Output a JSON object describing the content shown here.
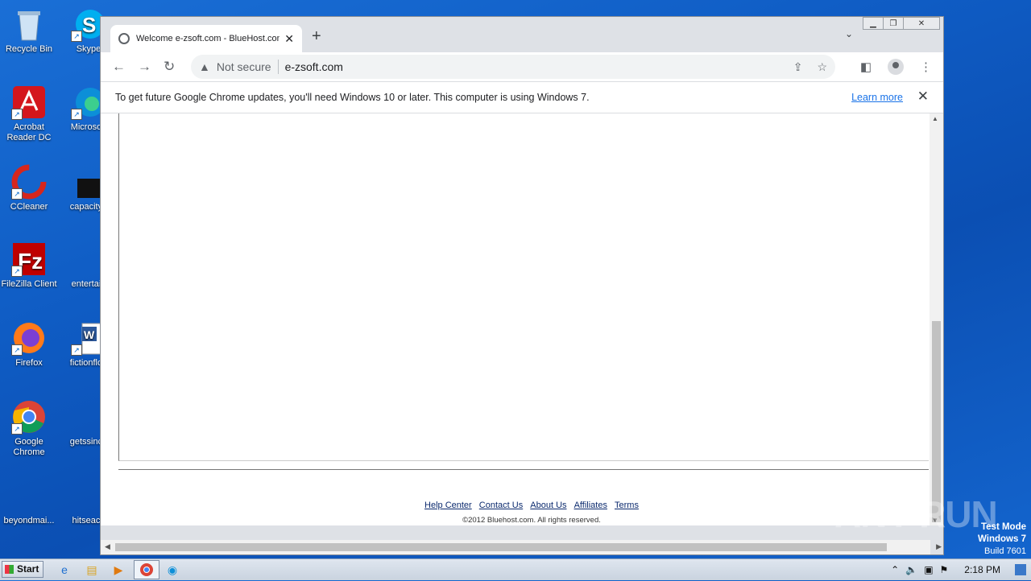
{
  "desktop": {
    "icons_col1": [
      {
        "label": "Recycle Bin",
        "icon": "recycle-bin-icon"
      },
      {
        "label": "Acrobat Reader DC",
        "icon": "acrobat-icon"
      },
      {
        "label": "CCleaner",
        "icon": "ccleaner-icon"
      },
      {
        "label": "FileZilla Client",
        "icon": "filezilla-icon"
      },
      {
        "label": "Firefox",
        "icon": "firefox-icon"
      },
      {
        "label": "Google Chrome",
        "icon": "chrome-icon"
      },
      {
        "label": "beyondmai...",
        "icon": "file-icon"
      }
    ],
    "icons_col2": [
      {
        "label": "Skype",
        "icon": "skype-icon"
      },
      {
        "label": "Microsoft",
        "icon": "edge-icon"
      },
      {
        "label": "capacityb",
        "icon": "file-icon"
      },
      {
        "label": "entertain",
        "icon": "file-icon"
      },
      {
        "label": "fictionflori",
        "icon": "word-icon"
      },
      {
        "label": "getssince",
        "icon": "file-icon"
      },
      {
        "label": "hitseach",
        "icon": "file-icon"
      }
    ]
  },
  "browser": {
    "tab_title": "Welcome e-zsoft.com - BlueHost.com",
    "tab_close": "✕",
    "new_tab": "+",
    "security_label": "Not secure",
    "url": "e-zsoft.com",
    "infobar": {
      "message": "To get future Google Chrome updates, you'll need Windows 10 or later. This computer is using Windows 7.",
      "link": "Learn more",
      "close": "✕"
    },
    "footer_links": [
      "Help Center",
      "Contact Us",
      "About Us",
      "Affiliates",
      "Terms"
    ],
    "copyright": "©2012 Bluehost.com. All rights reserved."
  },
  "taskbar": {
    "start_label": "Start",
    "clock": "2:18 PM"
  },
  "watermark": "ANY RUN",
  "testmode": {
    "line1": "Test Mode",
    "line2": "Windows 7",
    "line3": "Build 7601"
  }
}
